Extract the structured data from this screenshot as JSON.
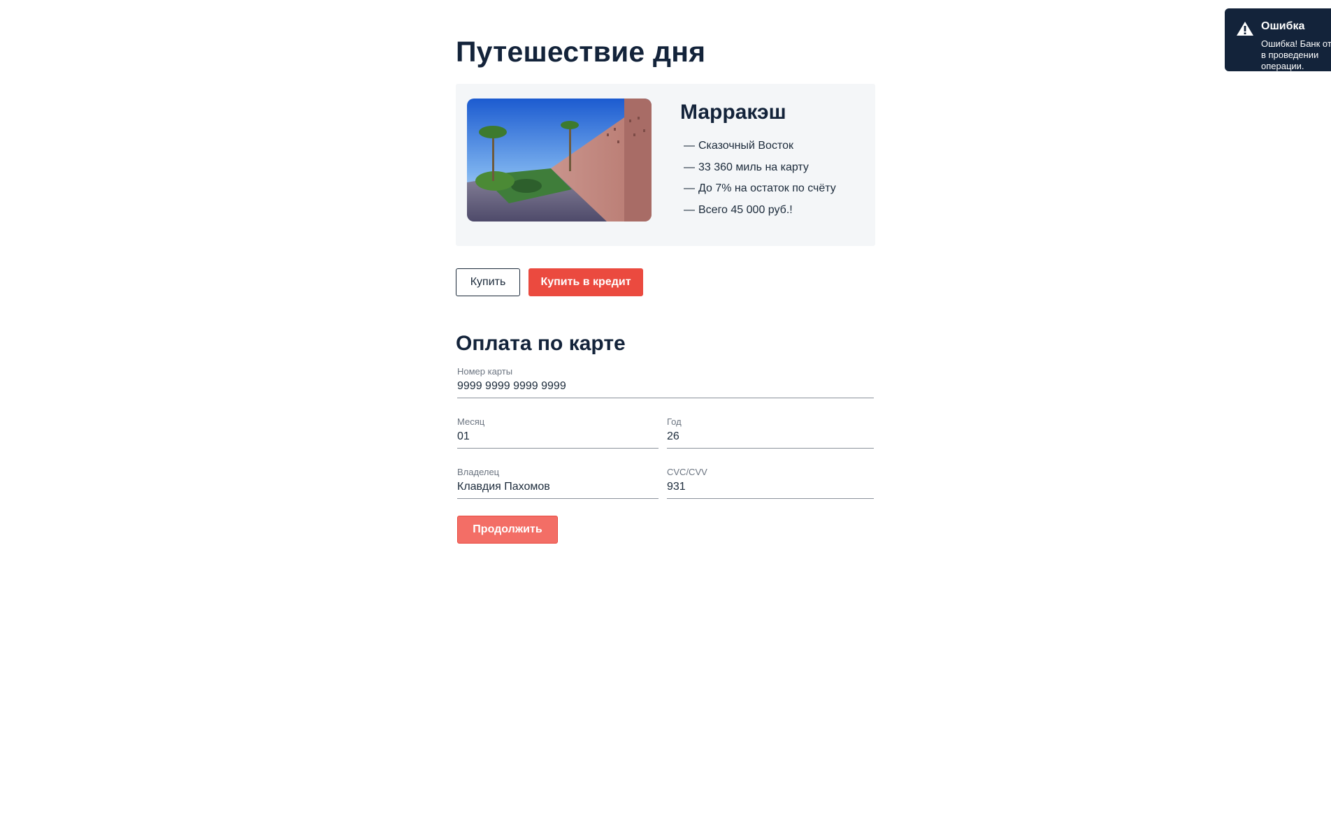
{
  "page": {
    "title": "Путешествие дня"
  },
  "offer": {
    "city": "Марракэш",
    "dash": "—",
    "features": [
      "Сказочный Восток",
      "33 360 миль на карту",
      "До 7% на остаток по счёту",
      "Всего 45 000 руб.!"
    ],
    "image_icon": "marrakesh-photo"
  },
  "actions": {
    "buy_label": "Купить",
    "buy_credit_label": "Купить в кредит"
  },
  "payment": {
    "title": "Оплата по карте",
    "card_number": {
      "label": "Номер карты",
      "value": "9999 9999 9999 9999"
    },
    "month": {
      "label": "Месяц",
      "value": "01"
    },
    "year": {
      "label": "Год",
      "value": "26"
    },
    "owner": {
      "label": "Владелец",
      "value": "Клавдия Пахомов"
    },
    "cvc": {
      "label": "CVC/CVV",
      "value": "931"
    },
    "continue_label": "Продолжить"
  },
  "notification": {
    "icon": "warning-icon",
    "title": "Ошибка",
    "text": "Ошибка! Банк отказал в проведении операции."
  },
  "colors": {
    "primary_red": "#eb4a3f",
    "disabled_red": "#f36e66",
    "dark_navy": "#13233a",
    "card_bg": "#f4f6f8"
  }
}
